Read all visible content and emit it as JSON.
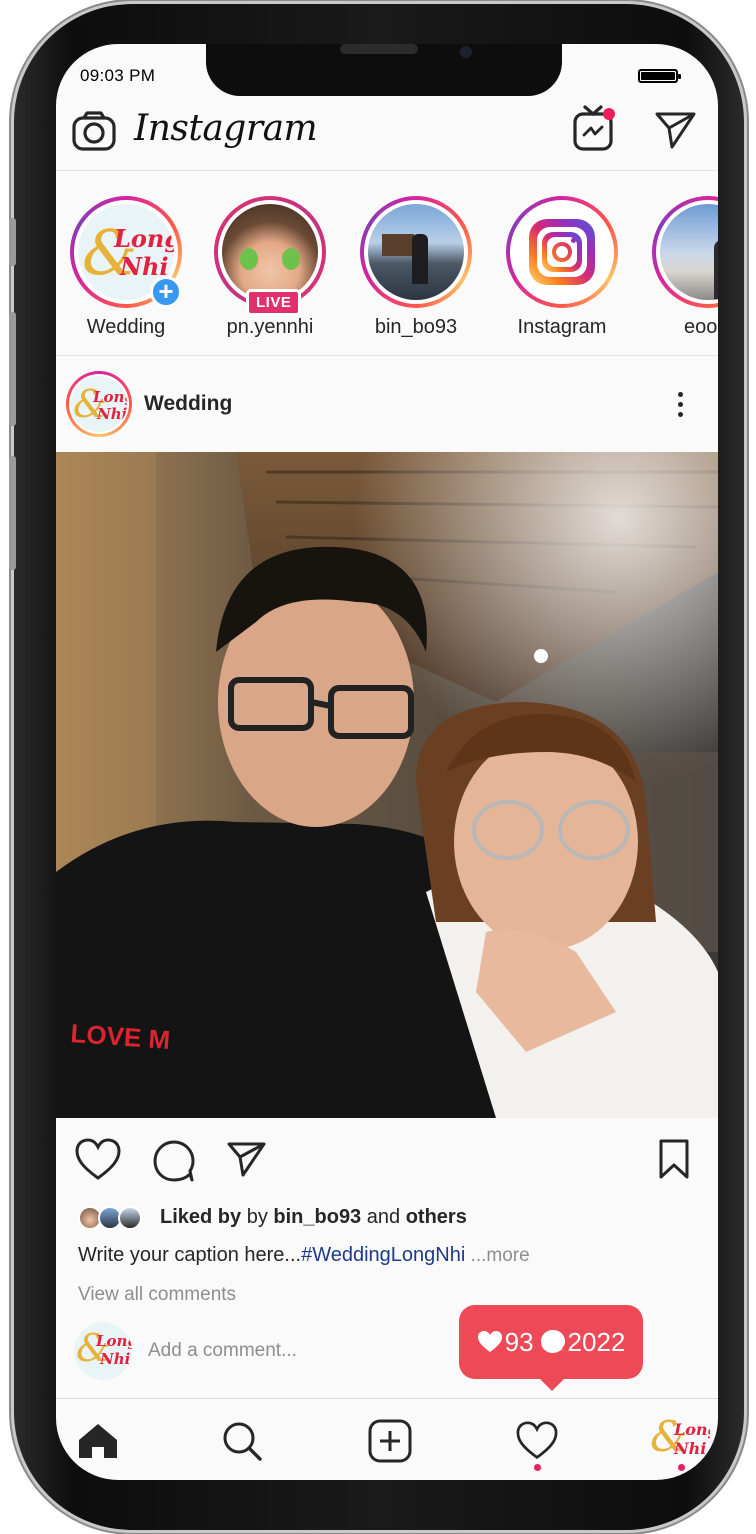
{
  "status_bar": {
    "time": "09:03 PM"
  },
  "header": {
    "logo_text": "Instagram",
    "igtv_icon": "tv-icon",
    "direct_icon": "paper-plane-icon",
    "camera_icon": "camera-icon"
  },
  "stories": [
    {
      "username": "Wedding",
      "type": "own-add",
      "avatar": "wedding-logo"
    },
    {
      "username": "pn.yennhi",
      "type": "live",
      "badge": "LIVE"
    },
    {
      "username": "bin_bo93",
      "type": "story"
    },
    {
      "username": "Instagram",
      "type": "story",
      "avatar": "instagram-logo"
    },
    {
      "username": "eoo",
      "type": "story"
    }
  ],
  "wedding_logo": {
    "word1": "Long",
    "word2": "Nhi",
    "ampersand": "&"
  },
  "post": {
    "author": "Wedding",
    "liked_prefix": "Liked by",
    "liked_user": "bin_bo93",
    "liked_and": "and",
    "liked_others": "others",
    "caption_text": "Write your caption here...",
    "caption_hashtag": "#WeddingLongNhi",
    "caption_more": " ...more",
    "view_all_comments": "View all comments",
    "add_comment_placeholder": "Add a comment...",
    "tshirt_text": "LOVE M"
  },
  "activity_bubble": {
    "likes": "93",
    "comments": "2022"
  },
  "colors": {
    "notification_red": "#ed4956",
    "live_pink": "#e1306c",
    "hashtag_blue": "#1e3a8a",
    "add_blue": "#3897f0"
  },
  "bottom_nav": [
    "home-icon",
    "search-icon",
    "add-post-icon",
    "activity-heart-icon",
    "profile-avatar"
  ]
}
